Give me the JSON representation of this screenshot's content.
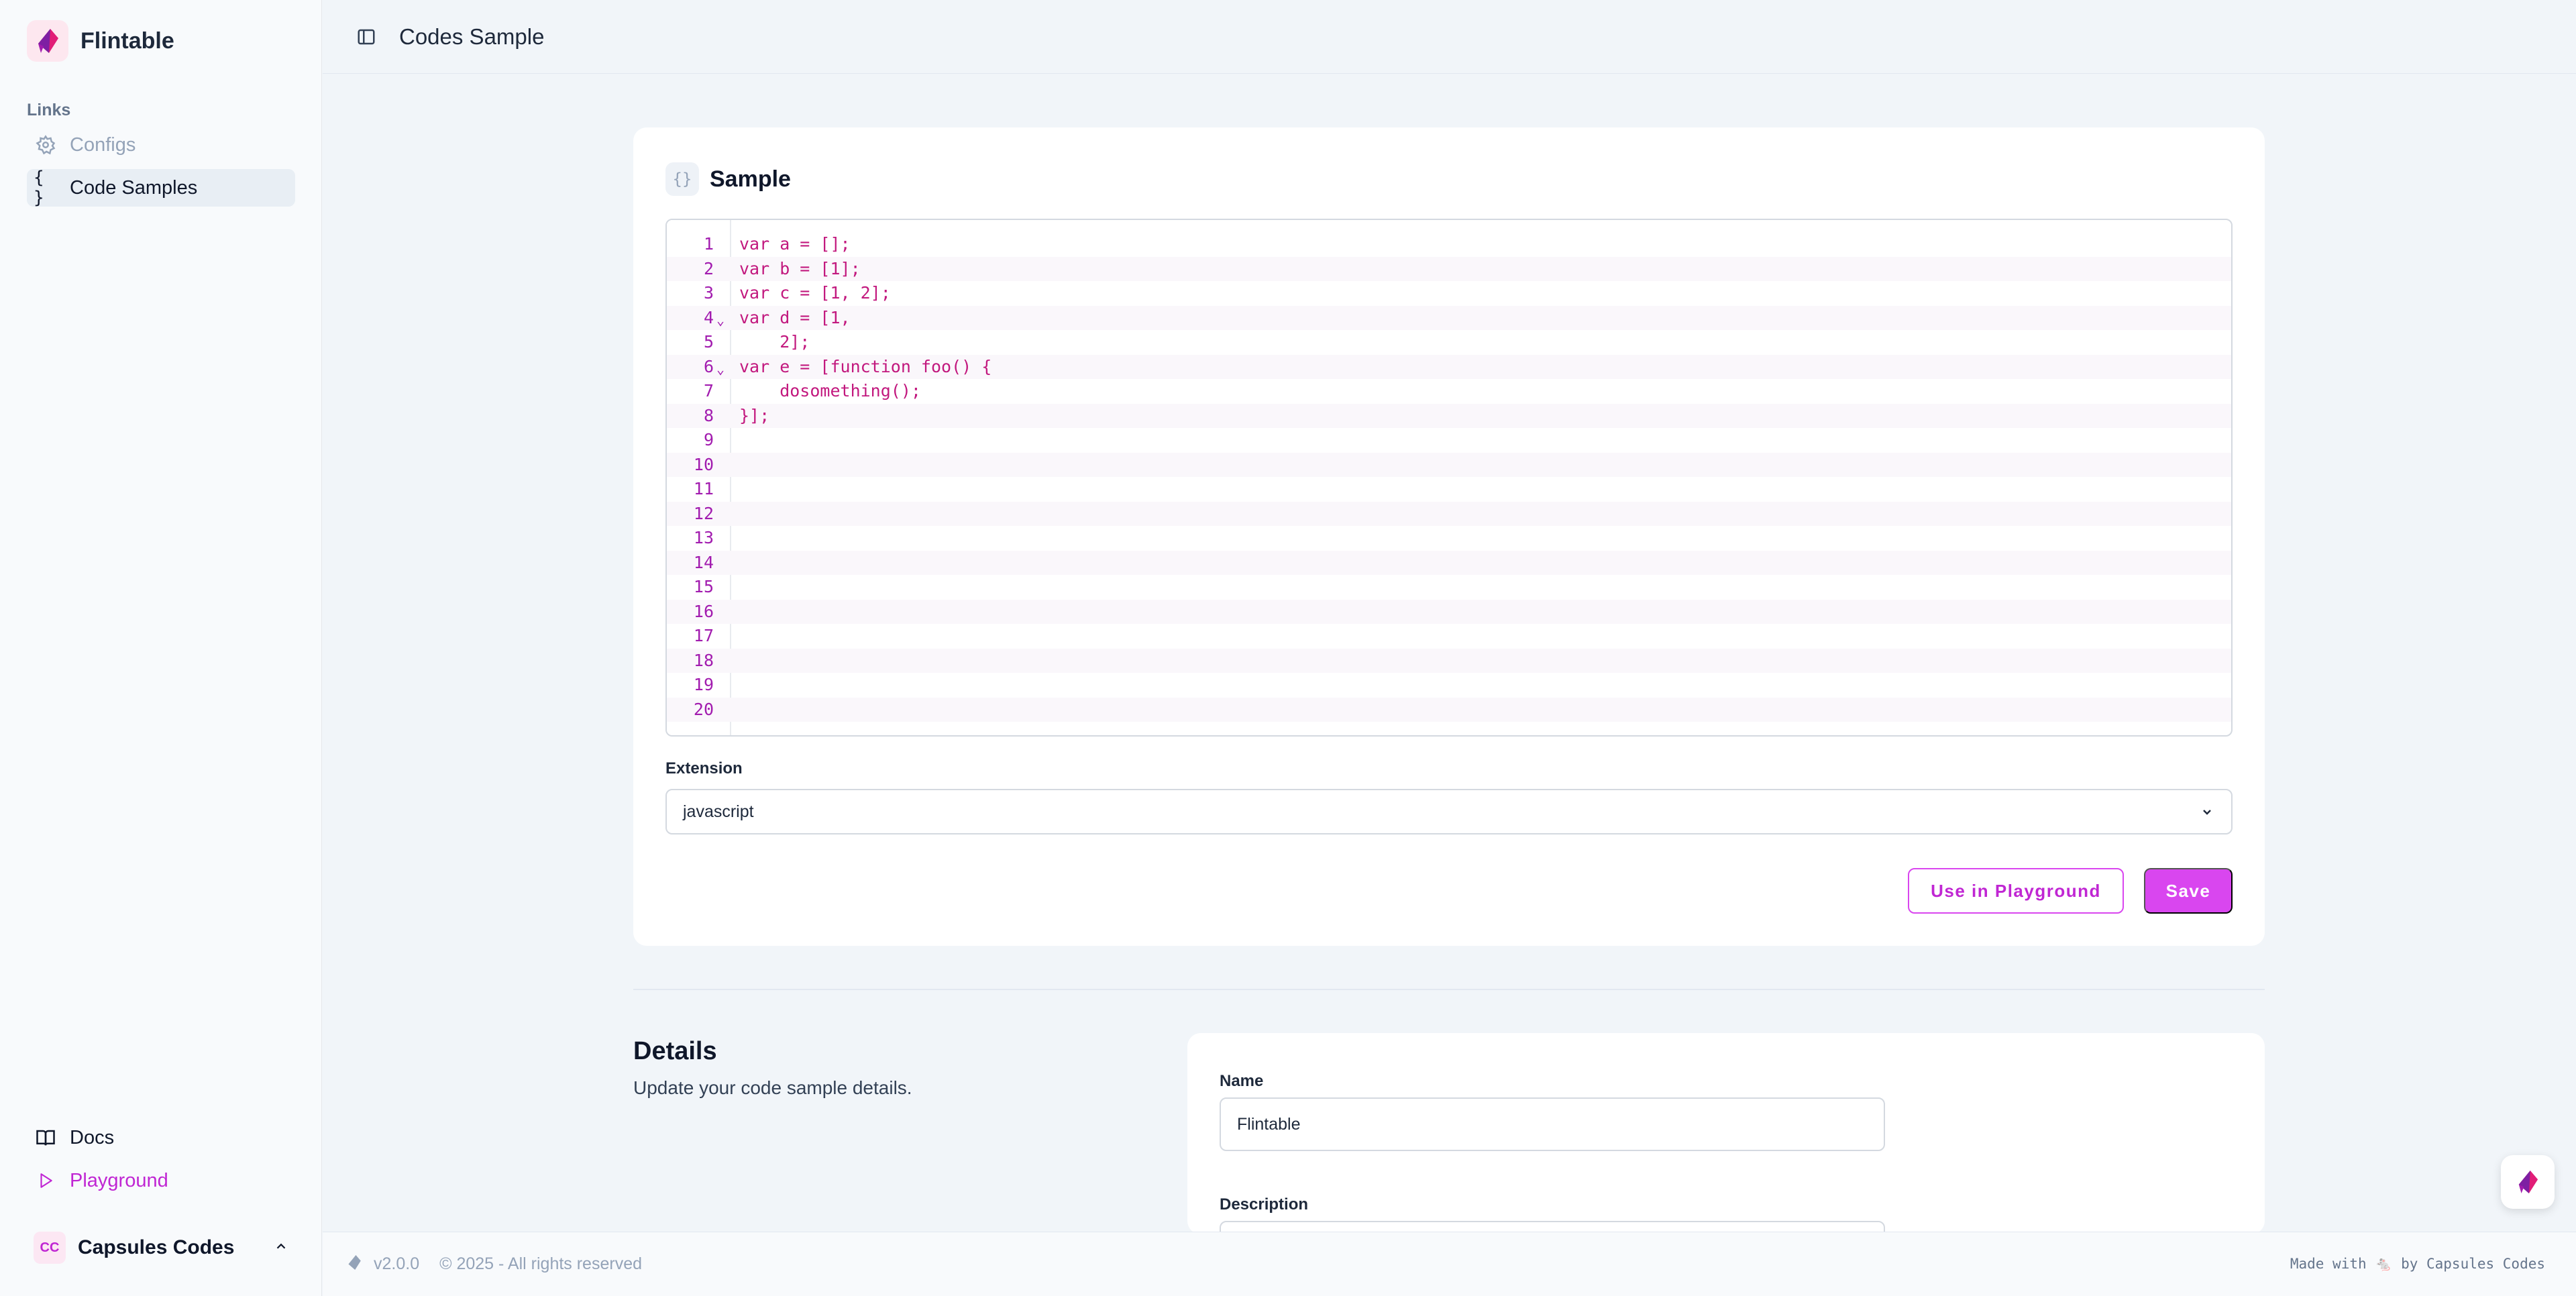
{
  "sidebar": {
    "brand": "Flintable",
    "section_label": "Links",
    "items": [
      {
        "label": "Configs",
        "icon": "gear-icon"
      },
      {
        "label": "Code Samples",
        "icon": "braces-icon"
      }
    ],
    "bottom_items": [
      {
        "label": "Docs",
        "icon": "book-icon"
      },
      {
        "label": "Playground",
        "icon": "play-icon"
      }
    ],
    "user": {
      "initials": "CC",
      "name": "Capsules Codes"
    }
  },
  "header": {
    "title": "Codes Sample"
  },
  "sample_card": {
    "title": "Sample",
    "badge": "{}",
    "code_lines": [
      {
        "num": "1",
        "code": "var a = [];",
        "fold": ""
      },
      {
        "num": "2",
        "code": "var b = [1];",
        "fold": ""
      },
      {
        "num": "3",
        "code": "var c = [1, 2];",
        "fold": ""
      },
      {
        "num": "4",
        "code": "var d = [1,",
        "fold": "⌄"
      },
      {
        "num": "5",
        "code": "    2];",
        "fold": ""
      },
      {
        "num": "6",
        "code": "var e = [function foo() {",
        "fold": "⌄"
      },
      {
        "num": "7",
        "code": "    dosomething();",
        "fold": ""
      },
      {
        "num": "8",
        "code": "}];",
        "fold": ""
      },
      {
        "num": "9",
        "code": "",
        "fold": ""
      },
      {
        "num": "10",
        "code": "",
        "fold": ""
      },
      {
        "num": "11",
        "code": "",
        "fold": ""
      },
      {
        "num": "12",
        "code": "",
        "fold": ""
      },
      {
        "num": "13",
        "code": "",
        "fold": ""
      },
      {
        "num": "14",
        "code": "",
        "fold": ""
      },
      {
        "num": "15",
        "code": "",
        "fold": ""
      },
      {
        "num": "16",
        "code": "",
        "fold": ""
      },
      {
        "num": "17",
        "code": "",
        "fold": ""
      },
      {
        "num": "18",
        "code": "",
        "fold": ""
      },
      {
        "num": "19",
        "code": "",
        "fold": ""
      },
      {
        "num": "20",
        "code": "",
        "fold": ""
      }
    ],
    "extension_label": "Extension",
    "extension_value": "javascript",
    "use_in_playground_label": "Use in Playground",
    "save_label": "Save"
  },
  "details": {
    "title": "Details",
    "subtitle": "Update your code sample details.",
    "name_label": "Name",
    "name_value": "Flintable",
    "description_label": "Description"
  },
  "footer": {
    "version": "v2.0.0",
    "copyright": "© 2025 - All rights reserved",
    "made_with": "Made with 🐁 by Capsules Codes"
  },
  "colors": {
    "accent": "#d946ef",
    "accent_text": "#c026d3",
    "code_text": "#c2187e",
    "background": "#f1f5f9"
  }
}
